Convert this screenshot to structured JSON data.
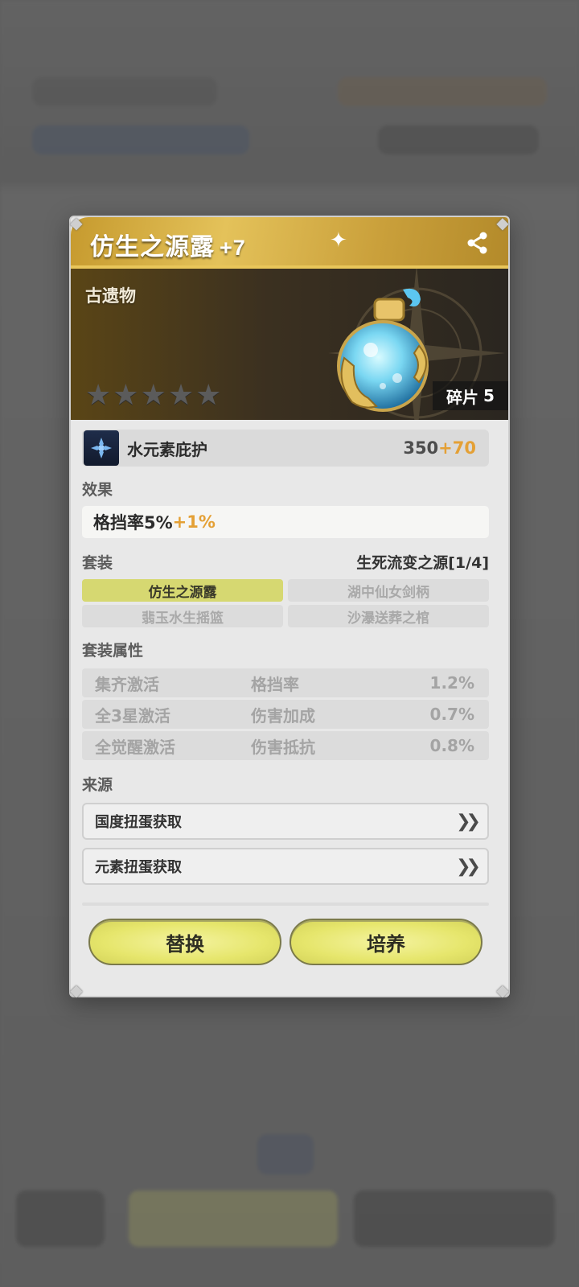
{
  "item": {
    "name": "仿生之源露",
    "level": "+7",
    "category": "古遗物",
    "stars": 5,
    "fragment_label": "碎片",
    "fragment_count": "5"
  },
  "main_stat": {
    "name": "水元素庇护",
    "value": "350",
    "bonus": "+70"
  },
  "effect": {
    "label": "效果",
    "text": "格挡率5%",
    "bonus": "+1%"
  },
  "set": {
    "label": "套装",
    "name": "生死流变之源[1/4]",
    "pieces": [
      {
        "label": "仿生之源露",
        "active": true
      },
      {
        "label": "湖中仙女剑柄",
        "active": false
      },
      {
        "label": "翡玉水生摇篮",
        "active": false
      },
      {
        "label": "沙瀑送葬之棺",
        "active": false
      }
    ]
  },
  "set_attributes": {
    "label": "套装属性",
    "rows": [
      {
        "condition": "集齐激活",
        "stat": "格挡率",
        "value": "1.2%"
      },
      {
        "condition": "全3星激活",
        "stat": "伤害加成",
        "value": "0.7%"
      },
      {
        "condition": "全觉醒激活",
        "stat": "伤害抵抗",
        "value": "0.8%"
      }
    ]
  },
  "source": {
    "label": "来源",
    "items": [
      "国度扭蛋获取",
      "元素扭蛋获取"
    ]
  },
  "buttons": {
    "replace": "替换",
    "train": "培养"
  },
  "colors": {
    "header_gold": "#e4c25a",
    "bonus_orange": "#e4a035",
    "button_yellow": "#e6e66c",
    "active_piece": "#d6d871"
  },
  "icons": {
    "share": "share-icon",
    "stat": "water-element-icon",
    "arrow": "double-chevron-right-icon"
  }
}
